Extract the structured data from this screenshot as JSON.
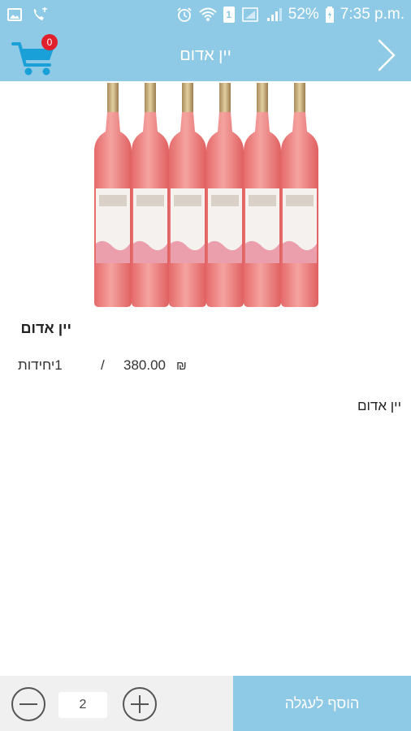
{
  "status_bar": {
    "battery": "52%",
    "time": "7:35 p.m.",
    "sim_label": "1",
    "icons": [
      "gallery-icon",
      "phone-icon",
      "alarm-icon",
      "wifi-icon",
      "sim-icon",
      "signal-icon",
      "battery-icon"
    ]
  },
  "header": {
    "title": "יין אדום",
    "cart_count": "0",
    "icons": [
      "cart-icon",
      "back-arrow-icon"
    ],
    "background": "#8ecae6"
  },
  "product": {
    "name": "יין אדום",
    "price": "380.00",
    "currency": "₪",
    "separator": "/",
    "units": "1יחידות",
    "description": "יין אדום",
    "bottle_count": 6
  },
  "bottom_bar": {
    "quantity": "2",
    "add_to_cart_label": "הוסף לעגלה",
    "icons": [
      "minus-circle-icon",
      "plus-circle-icon"
    ]
  },
  "colors": {
    "accent": "#8ecae6",
    "badge": "#e0202a",
    "bottom_bar": "#f0f0f0",
    "wine": "#f08a8a"
  }
}
